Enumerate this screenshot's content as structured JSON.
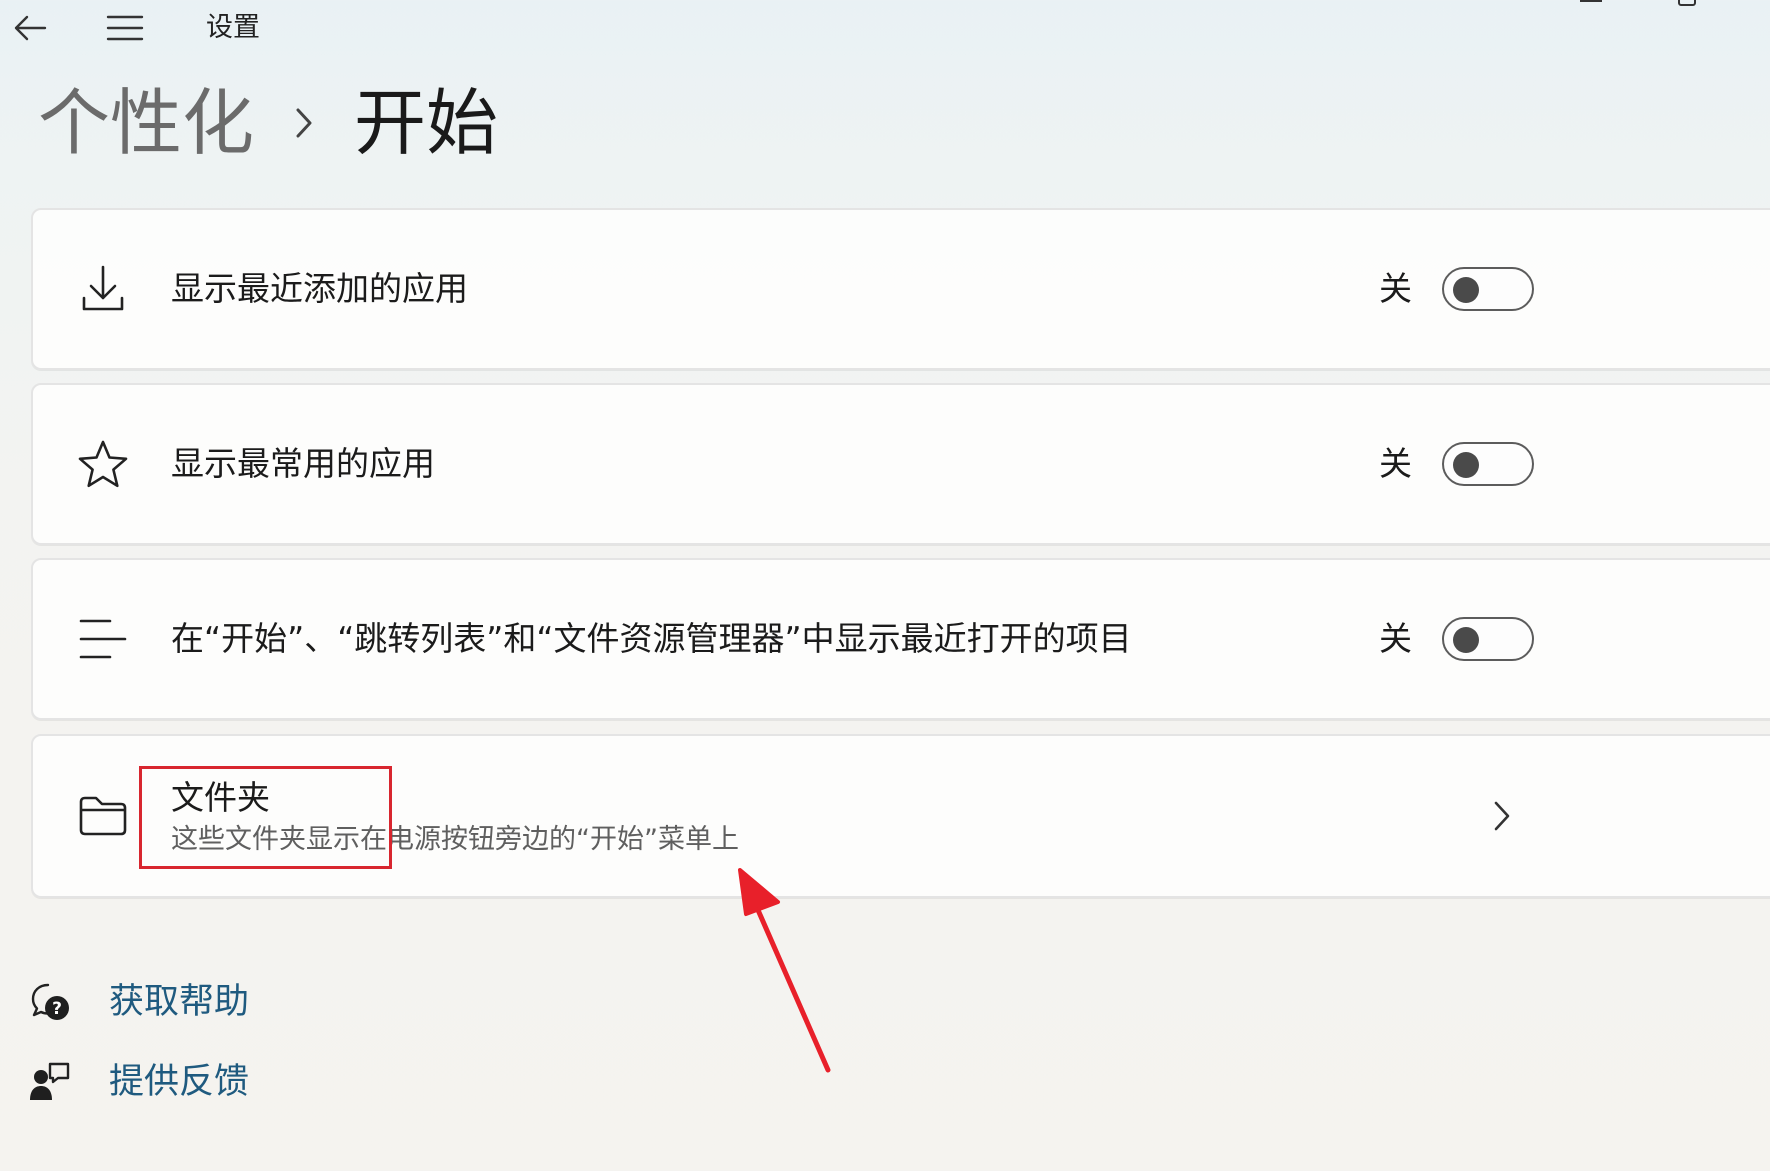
{
  "window": {
    "title": "设置"
  },
  "breadcrumb": {
    "parent": "个性化",
    "current": "开始"
  },
  "settings": [
    {
      "label": "显示最近添加的应用",
      "icon": "download-icon",
      "state": "关",
      "on": false
    },
    {
      "label": "显示最常用的应用",
      "icon": "star-icon",
      "state": "关",
      "on": false
    },
    {
      "label": "在“开始”、“跳转列表”和“文件资源管理器”中显示最近打开的项目",
      "icon": "list-icon",
      "state": "关",
      "on": false
    }
  ],
  "folders": {
    "title": "文件夹",
    "description": "这些文件夹显示在电源按钮旁边的“开始”菜单上",
    "icon": "folder-icon"
  },
  "footer": {
    "help": "获取帮助",
    "feedback": "提供反馈"
  },
  "colors": {
    "accent_link": "#1f5a7f",
    "annotation_red": "#d8262f",
    "toggle_off_knob": "#4a4a4a"
  }
}
